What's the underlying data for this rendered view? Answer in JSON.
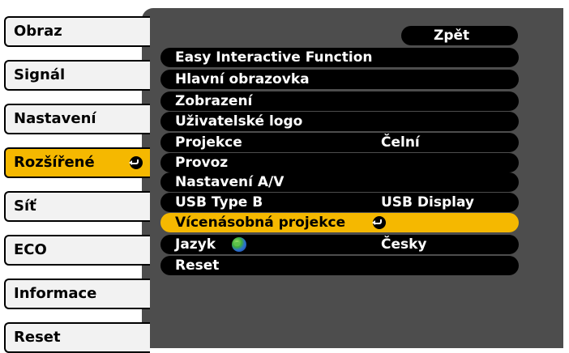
{
  "tabs": [
    {
      "label": "Obraz",
      "active": false
    },
    {
      "label": "Signál",
      "active": false
    },
    {
      "label": "Nastavení",
      "active": false
    },
    {
      "label": "Rozšířené",
      "active": true
    },
    {
      "label": "Síť",
      "active": false
    },
    {
      "label": "ECO",
      "active": false
    },
    {
      "label": "Informace",
      "active": false
    },
    {
      "label": "Reset",
      "active": false
    }
  ],
  "back_label": "Zpět",
  "menu_items": [
    {
      "label": "Easy Interactive Function",
      "value": ""
    },
    {
      "label": "Hlavní obrazovka",
      "value": ""
    },
    {
      "label": "Zobrazení",
      "value": ""
    },
    {
      "label": "Uživatelské logo",
      "value": ""
    },
    {
      "label": "Projekce",
      "value": "Čelní"
    },
    {
      "label": "Provoz",
      "value": ""
    },
    {
      "label": "Nastavení A/V",
      "value": ""
    },
    {
      "label": "USB Type B",
      "value": "USB Display"
    },
    {
      "label": "Vícenásobná projekce",
      "value": "",
      "selected": true,
      "icon": "enter-icon"
    },
    {
      "label": "Jazyk",
      "value": "Česky",
      "icon": "globe-icon"
    },
    {
      "label": "Reset",
      "value": ""
    }
  ],
  "colors": {
    "accent": "#f5b800",
    "panel": "#4d4d4d",
    "row": "#000000",
    "tab": "#f2f2f2"
  }
}
